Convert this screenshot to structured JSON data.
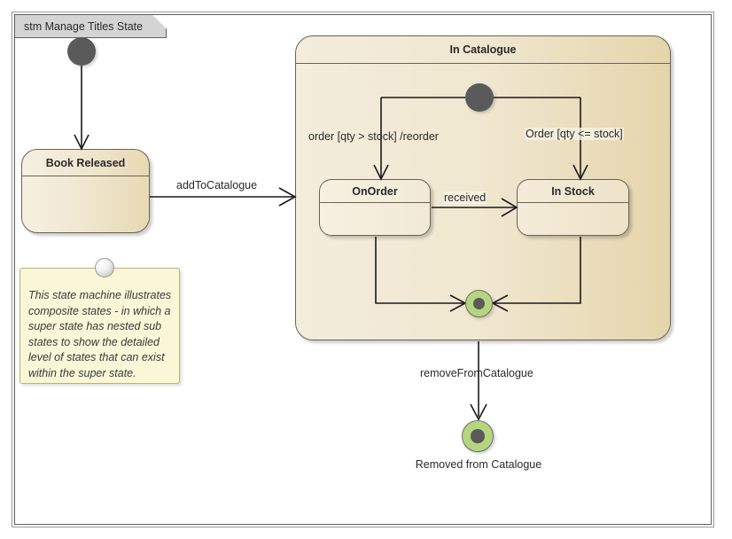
{
  "diagram": {
    "title": "stm Manage Titles State",
    "colors": {
      "frame_border": "#5e5e5e",
      "tab_fill": "#d4d4d4",
      "state_fill_light": "#f4eddc",
      "state_fill_dark": "#e5d5ab",
      "state_border": "#6b6255",
      "initial_node": "#5a5a5a",
      "final_node_ring": "#b5d57e",
      "note_fill": "#f9f7d8",
      "note_border": "#b8b470",
      "connector": "#1a1a1a"
    }
  },
  "states": {
    "book_released": {
      "name": "Book Released"
    },
    "in_catalogue": {
      "name": "In Catalogue"
    },
    "on_order": {
      "name": "OnOrder"
    },
    "in_stock": {
      "name": "In Stock"
    }
  },
  "nodes": {
    "initial_main": {
      "kind": "initial-node"
    },
    "initial_catalogue": {
      "kind": "initial-node"
    },
    "final_catalogue": {
      "kind": "final-node"
    },
    "final_removed": {
      "kind": "final-node",
      "caption": "Removed from Catalogue"
    }
  },
  "transitions": {
    "add_to_catalogue": "addToCatalogue",
    "order_reorder": "order [qty > stock] /reorder",
    "order_lte_stock": "Order [qty <= stock]",
    "received": "received",
    "remove_from_catalogue": "removeFromCatalogue"
  },
  "note": {
    "text": "This state machine illustrates composite states - in which a super state has nested sub states to show the detailed level of states that can exist within the super state."
  }
}
